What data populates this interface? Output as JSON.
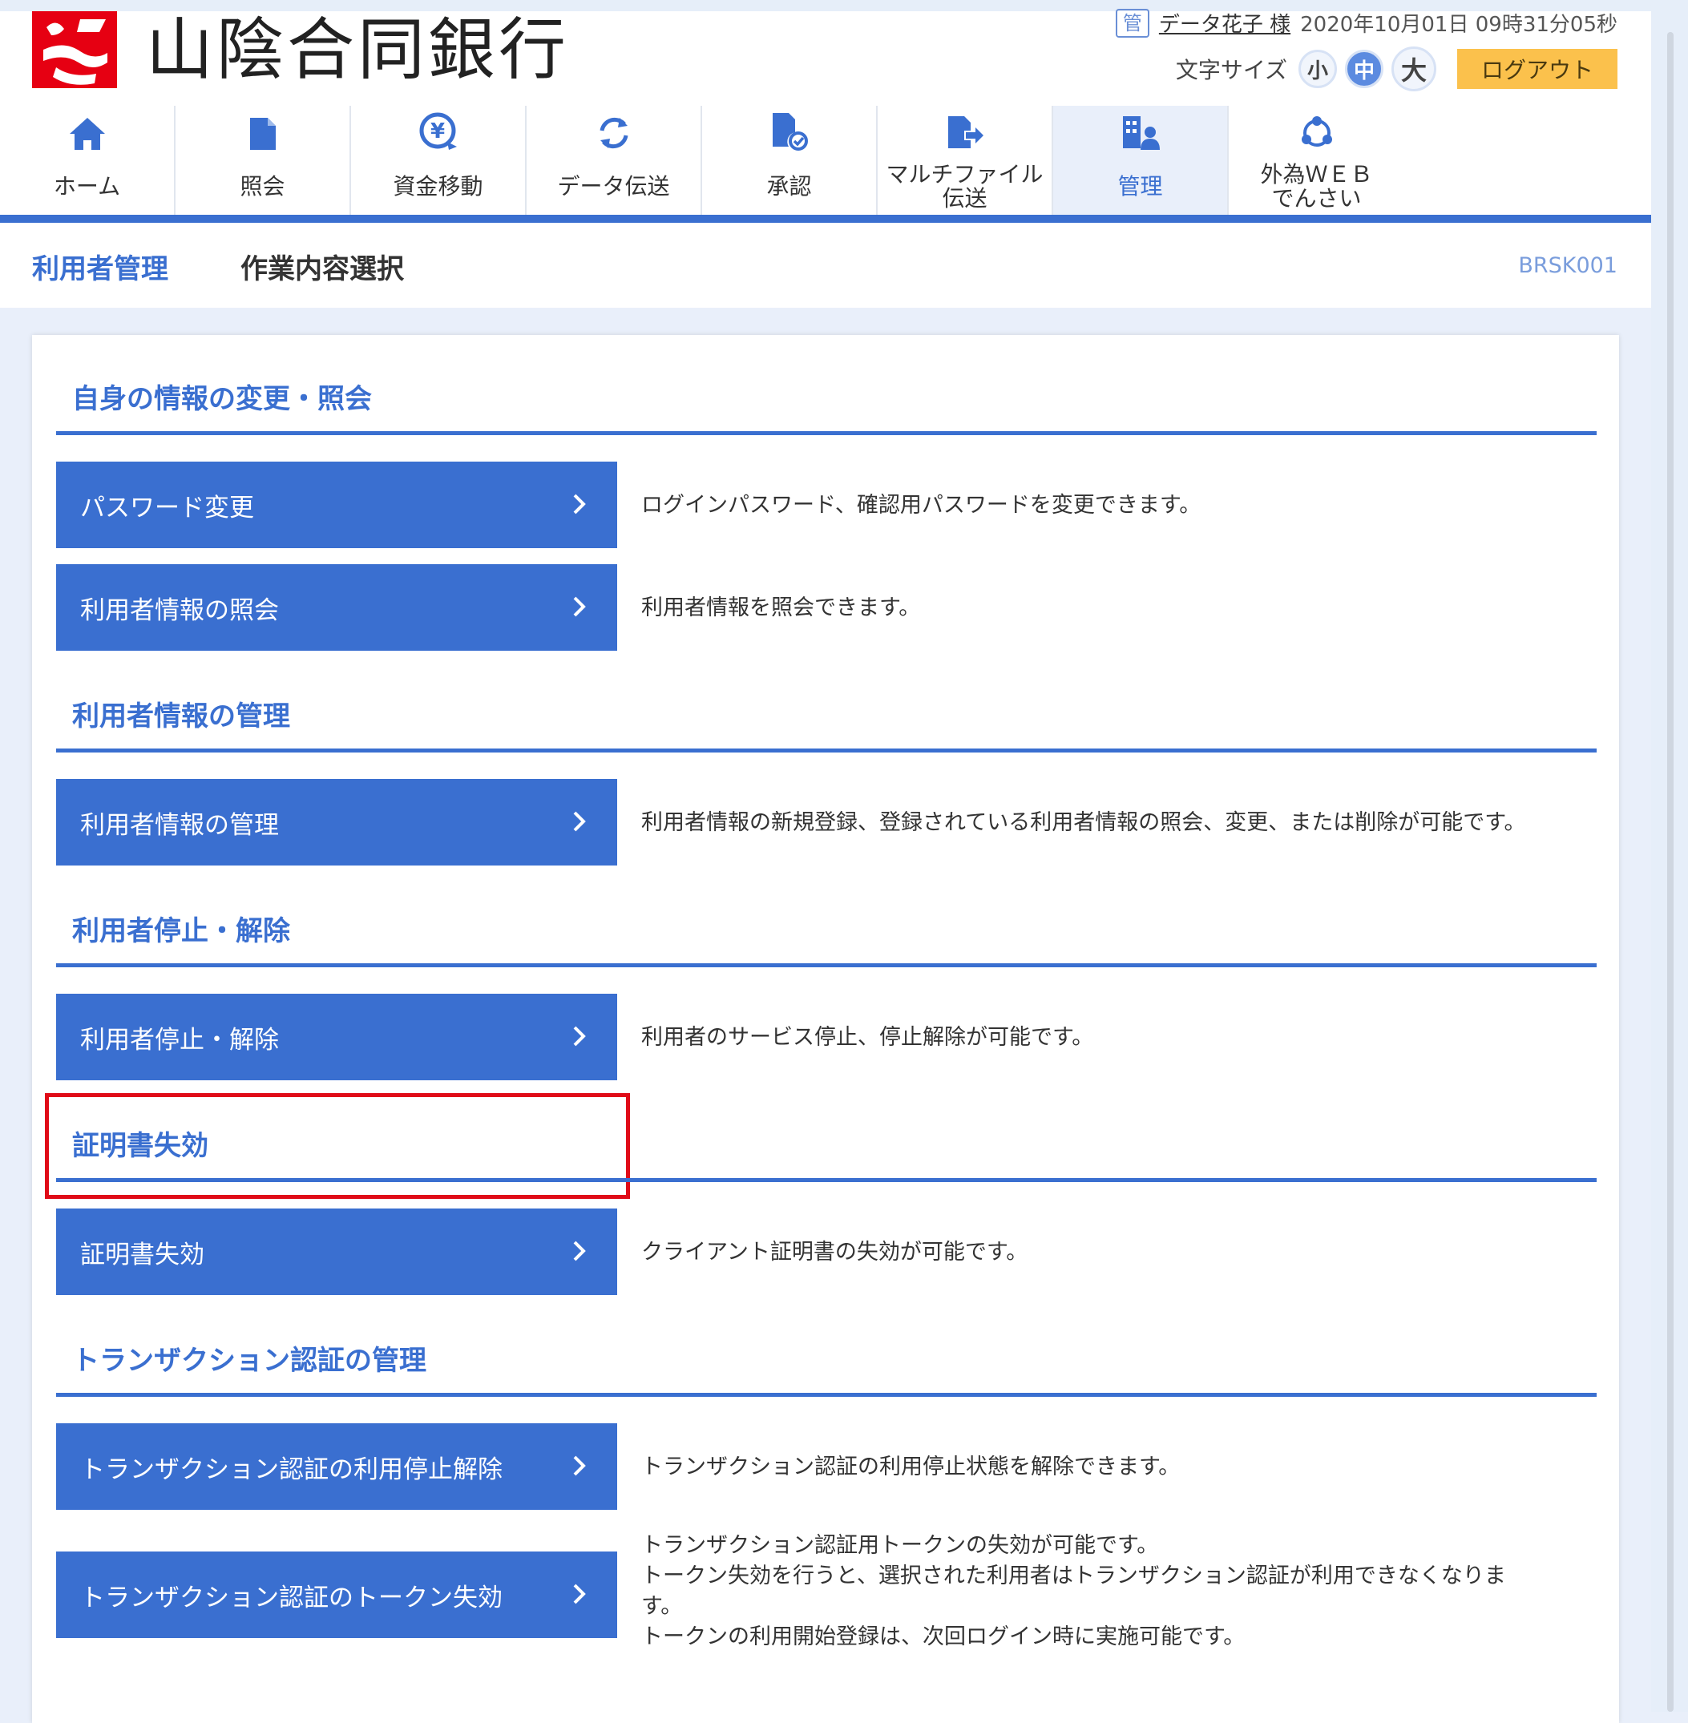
{
  "header": {
    "bank_name": "山陰合同銀行",
    "user_role_badge": "管",
    "user_name": "データ花子 様",
    "datetime": "2020年10月01日 09時31分05秒",
    "font_size_label": "文字サイズ",
    "font_sizes": [
      "小",
      "中",
      "大"
    ],
    "active_font_size": "中",
    "logout_label": "ログアウト"
  },
  "nav": {
    "items": [
      {
        "label": "ホーム",
        "icon": "home-icon"
      },
      {
        "label": "照会",
        "icon": "document-icon"
      },
      {
        "label": "資金移動",
        "icon": "yen-transfer-icon"
      },
      {
        "label": "データ伝送",
        "icon": "refresh-icon"
      },
      {
        "label": "承認",
        "icon": "approval-icon"
      },
      {
        "label": "マルチファイル\n伝送",
        "icon": "file-transfer-icon"
      },
      {
        "label": "管理",
        "icon": "management-icon"
      },
      {
        "label": "外為ＷＥＢ\nでんさい",
        "icon": "network-icon"
      }
    ],
    "active": "管理"
  },
  "page": {
    "category": "利用者管理",
    "title": "作業内容選択",
    "screen_id": "BRSK001"
  },
  "sections": [
    {
      "title": "自身の情報の変更・照会",
      "actions": [
        {
          "label": "パスワード変更",
          "desc": "ログインパスワード、確認用パスワードを変更できます。"
        },
        {
          "label": "利用者情報の照会",
          "desc": "利用者情報を照会できます。"
        }
      ]
    },
    {
      "title": "利用者情報の管理",
      "actions": [
        {
          "label": "利用者情報の管理",
          "desc": "利用者情報の新規登録、登録されている利用者情報の照会、変更、または削除が可能です。",
          "highlighted": true
        }
      ]
    },
    {
      "title": "利用者停止・解除",
      "actions": [
        {
          "label": "利用者停止・解除",
          "desc": "利用者のサービス停止、停止解除が可能です。"
        }
      ]
    },
    {
      "title": "証明書失効",
      "actions": [
        {
          "label": "証明書失効",
          "desc": "クライアント証明書の失効が可能です。"
        }
      ]
    },
    {
      "title": "トランザクション認証の管理",
      "actions": [
        {
          "label": "トランザクション認証の利用停止解除",
          "desc": "トランザクション認証の利用停止状態を解除できます。"
        },
        {
          "label": "トランザクション認証のトークン失効",
          "desc_lines": [
            "トランザクション認証用トークンの失効が可能です。",
            "トークン失効を行うと、選択された利用者はトランザクション認証が利用できなくなりま",
            "す。",
            "トークンの利用開始登録は、次回ログイン時に実施可能です。"
          ]
        }
      ]
    }
  ],
  "colors": {
    "primary": "#3a6fd0",
    "highlight": "#e00b18",
    "logout": "#fbc14c",
    "logo": "#e60012"
  }
}
